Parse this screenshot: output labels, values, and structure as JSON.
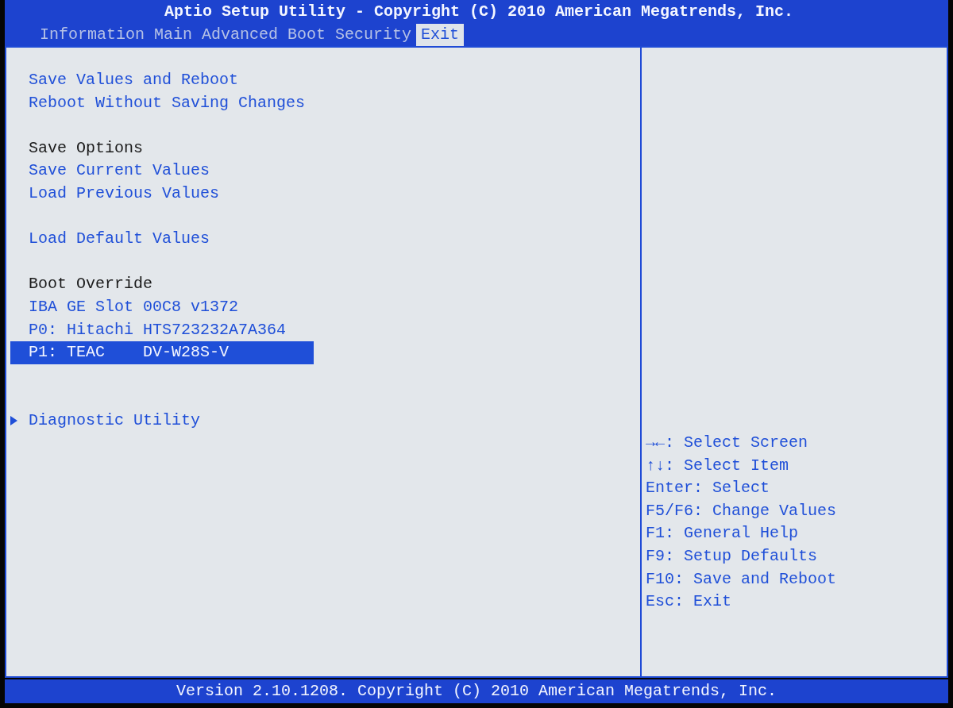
{
  "title": "Aptio Setup Utility - Copyright (C) 2010 American Megatrends, Inc.",
  "tabs": [
    {
      "label": "Information",
      "selected": false
    },
    {
      "label": "Main",
      "selected": false
    },
    {
      "label": "Advanced",
      "selected": false
    },
    {
      "label": "Boot",
      "selected": false
    },
    {
      "label": "Security",
      "selected": false
    },
    {
      "label": "Exit",
      "selected": true
    }
  ],
  "menu_groups": [
    {
      "items": [
        {
          "kind": "option",
          "label": "Save Values and Reboot",
          "selected": false
        },
        {
          "kind": "option",
          "label": "Reboot Without Saving Changes",
          "selected": false
        }
      ]
    },
    {
      "items": [
        {
          "kind": "heading",
          "label": "Save Options"
        },
        {
          "kind": "option",
          "label": "Save Current Values",
          "selected": false
        },
        {
          "kind": "option",
          "label": "Load Previous Values",
          "selected": false
        }
      ]
    },
    {
      "items": [
        {
          "kind": "option",
          "label": "Load Default Values",
          "selected": false
        }
      ]
    },
    {
      "items": [
        {
          "kind": "heading",
          "label": "Boot Override"
        },
        {
          "kind": "option",
          "label": "IBA GE Slot 00C8 v1372",
          "selected": false
        },
        {
          "kind": "option",
          "label": "P0: Hitachi HTS723232A7A364",
          "selected": false
        },
        {
          "kind": "option",
          "label": "P1: TEAC    DV-W28S-V",
          "selected": true
        }
      ]
    }
  ],
  "submenus": [
    {
      "label": "Diagnostic Utility",
      "selected": false
    }
  ],
  "help": [
    "→←: Select Screen",
    "↑↓: Select Item",
    "Enter: Select",
    "F5/F6: Change Values",
    "F1: General Help",
    "F9: Setup Defaults",
    "F10: Save and Reboot",
    "Esc: Exit"
  ],
  "footer": "Version 2.10.1208. Copyright (C) 2010 American Megatrends, Inc."
}
